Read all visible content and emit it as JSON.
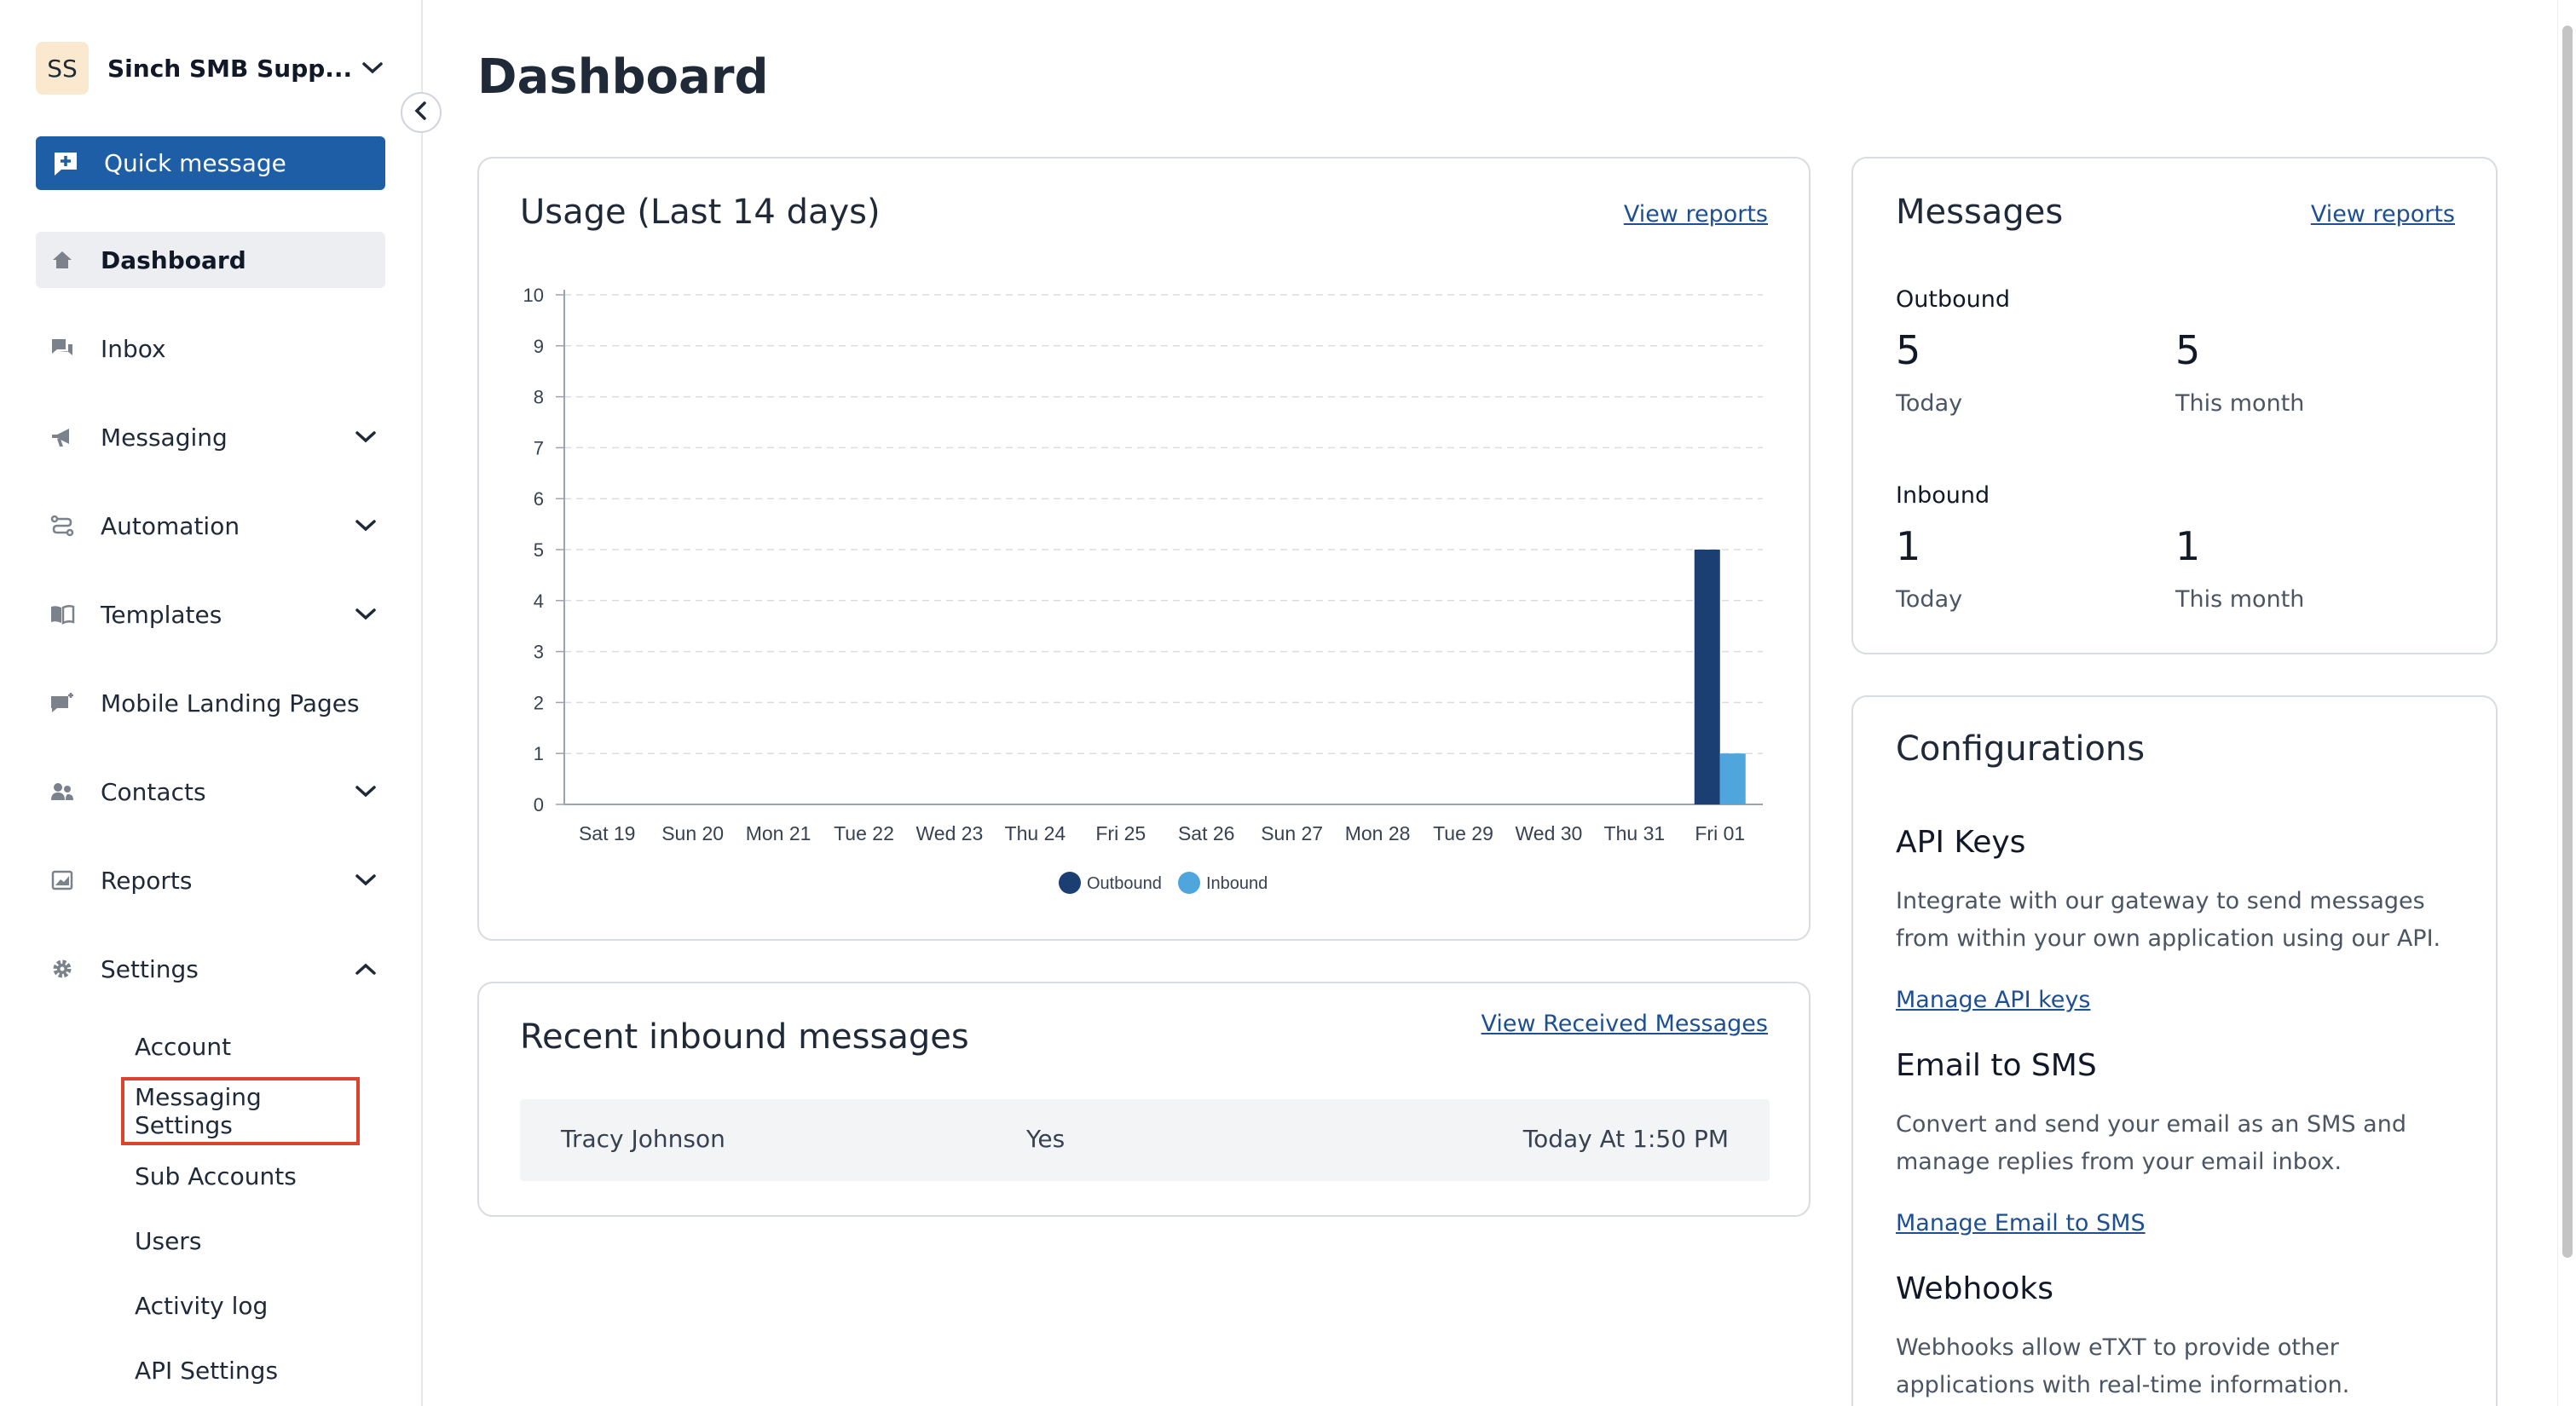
{
  "sidebar": {
    "org_initials": "SS",
    "org_name": "Sinch SMB Supp...",
    "quick_message": "Quick message",
    "items": [
      {
        "label": "Dashboard",
        "icon": "home-icon",
        "active": true,
        "expandable": false
      },
      {
        "label": "Inbox",
        "icon": "chat-icon",
        "active": false,
        "expandable": false
      },
      {
        "label": "Messaging",
        "icon": "megaphone-icon",
        "active": false,
        "expandable": true
      },
      {
        "label": "Automation",
        "icon": "workflow-icon",
        "active": false,
        "expandable": true
      },
      {
        "label": "Templates",
        "icon": "book-icon",
        "active": false,
        "expandable": true
      },
      {
        "label": "Mobile Landing Pages",
        "icon": "landing-page-icon",
        "active": false,
        "expandable": false
      },
      {
        "label": "Contacts",
        "icon": "contacts-icon",
        "active": false,
        "expandable": true
      },
      {
        "label": "Reports",
        "icon": "reports-icon",
        "active": false,
        "expandable": true
      },
      {
        "label": "Settings",
        "icon": "gear-icon",
        "active": false,
        "expandable": true,
        "expanded": true
      }
    ],
    "settings_sub": [
      "Account",
      "Messaging Settings",
      "Sub Accounts",
      "Users",
      "Activity log",
      "API Settings"
    ]
  },
  "page_title": "Dashboard",
  "usage": {
    "title": "Usage (Last 14 days)",
    "view_reports": "View reports"
  },
  "chart_data": {
    "type": "bar",
    "categories": [
      "Sat 19",
      "Sun 20",
      "Mon 21",
      "Tue 22",
      "Wed 23",
      "Thu 24",
      "Fri 25",
      "Sat 26",
      "Sun 27",
      "Mon 28",
      "Tue 29",
      "Wed 30",
      "Thu 31",
      "Fri 01"
    ],
    "series": [
      {
        "name": "Outbound",
        "color": "#1b3f72",
        "values": [
          0,
          0,
          0,
          0,
          0,
          0,
          0,
          0,
          0,
          0,
          0,
          0,
          0,
          5
        ]
      },
      {
        "name": "Inbound",
        "color": "#4ea6dc",
        "values": [
          0,
          0,
          0,
          0,
          0,
          0,
          0,
          0,
          0,
          0,
          0,
          0,
          0,
          1
        ]
      }
    ],
    "ylim": [
      0,
      10
    ],
    "yticks": [
      0,
      1,
      2,
      3,
      4,
      5,
      6,
      7,
      8,
      9,
      10
    ],
    "grid": true,
    "legend": "bottom-center"
  },
  "recent": {
    "title": "Recent inbound messages",
    "view_link": "View Received Messages",
    "rows": [
      {
        "name": "Tracy Johnson",
        "status": "Yes",
        "time": "Today At 1:50 PM"
      }
    ]
  },
  "messages": {
    "title": "Messages",
    "view_reports": "View reports",
    "outbound_label": "Outbound",
    "outbound_today": "5",
    "outbound_month": "5",
    "inbound_label": "Inbound",
    "inbound_today": "1",
    "inbound_month": "1",
    "today": "Today",
    "this_month": "This month"
  },
  "config": {
    "title": "Configurations",
    "api_title": "API Keys",
    "api_desc": "Integrate with our gateway to send messages from within your own application using our API.",
    "api_link": "Manage API keys",
    "email_title": "Email to SMS",
    "email_desc": "Convert and send your email as an SMS and manage replies from your email inbox.",
    "email_link": "Manage Email to SMS",
    "webhooks_title": "Webhooks",
    "webhooks_desc": "Webhooks allow eTXT to provide other applications with real-time information."
  }
}
